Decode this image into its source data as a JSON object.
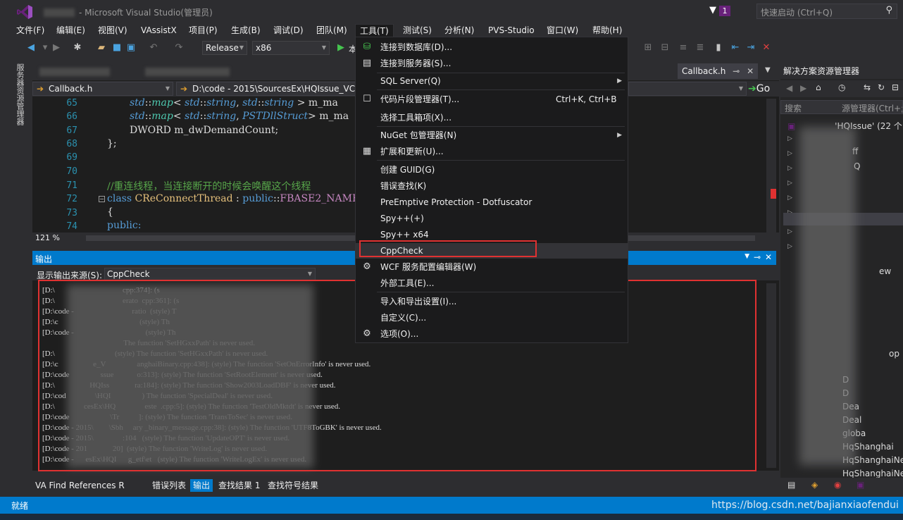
{
  "window": {
    "title": "- Microsoft Visual Studio(管理员)",
    "notification_count": "1",
    "quick_launch_placeholder": "快速启动 (Ctrl+Q)"
  },
  "menubar": [
    "文件(F)",
    "编辑(E)",
    "视图(V)",
    "VAssistX",
    "项目(P)",
    "生成(B)",
    "调试(D)",
    "团队(M)",
    "工具(T)",
    "测试(S)",
    "分析(N)",
    "PVS-Studio",
    "窗口(W)",
    "帮助(H)"
  ],
  "toolbar": {
    "configuration": "Release",
    "platform": "x86",
    "run_label": "本"
  },
  "left_sidebar": {
    "label": "服务器资源管理器"
  },
  "editor": {
    "tabs": [
      "Callback.h"
    ],
    "active_tab_right": "Callback.h",
    "nav_file": "Callback.h",
    "nav_scope": "D:\\code - 2015\\SourcesEx\\HQIssue_VC",
    "go_label": "Go",
    "zoom": "121 %",
    "lines": [
      {
        "num": "65",
        "text": "std::map< std::string, std::string > m_ma"
      },
      {
        "num": "66",
        "text": "std::map< std::string, PSTDllStruct> m_ma"
      },
      {
        "num": "67",
        "text": "DWORD m_dwDemandCount;"
      },
      {
        "num": "68",
        "text": "};"
      },
      {
        "num": "69",
        "text": ""
      },
      {
        "num": "70",
        "text": ""
      },
      {
        "num": "71",
        "text": "//重连线程，当连接断开的时候会唤醒这个线程"
      },
      {
        "num": "72",
        "text": "class CReConnectThread : public::FBASE2_NAMES"
      },
      {
        "num": "73",
        "text": "{"
      },
      {
        "num": "74",
        "text": "public:"
      }
    ]
  },
  "output": {
    "title": "输出",
    "source_label": "显示输出来源(S):",
    "source_value": "CppCheck",
    "lines": [
      "[D:\\                                   cpp:374]: (s",
      "[D:\\                                   erato  cpp:361]: (s",
      "[D:\\code -                              ratio  (style) T",
      "[D:\\c                                          (style) Th",
      "[D:\\code -                                     (style) Th",
      "                                          The function 'SetHGxxPath' is never used.",
      "[D:\\                               (style) The function 'SetHGxxPath' is never used.",
      "[D:\\c                  e_V                anghaiBinary.cpp:438]: (style) The function 'SetOnErrorInfo' is never used.",
      "[D:\\code                ssue            o:313]: (style) The function 'SetRootElement' is never used.",
      "[D:\\                  HQIss             ra:184]: (style) The function 'Show2003LoadDBF' is never used.",
      "[D:\\cod               \\HQI                ) The function 'SpecialDeal' is never used.",
      "[D:\\               cesEx\\HQ               este  .cpp:5]: (style) The function 'TestOldMktdt' is never used.",
      "[D:\\code                     \\Tr          ]: (style) The function 'TransToSec' is never used.",
      "[D:\\code - 2015\\        \\Sbh     ary _binary_message.cpp:38]: (style) The function 'UTF8ToGBK' is never used.",
      "[D:\\code - 2015\\               :104   (style) The function 'UpdateOPT' is never used.",
      "[D:\\code - 201             20]  (style) The function 'WriteLog' is never used.",
      "[D:\\code -      esEx\\HQI      g_etf\\et   (style) The function 'WriteLogEx' is never used."
    ]
  },
  "bottom_tabs": [
    "VA Find References R",
    "错误列表",
    "输出",
    "查找结果 1",
    "查找符号结果"
  ],
  "status": {
    "ready": "就绪",
    "watermark": "https://blog.csdn.net/bajianxiaofendui"
  },
  "solution_explorer": {
    "title": "解决方案资源管理器",
    "search_placeholder": "搜索",
    "search_suffix": "源管理器(Ctrl+;",
    "root": "'HQIssue' (22 个",
    "items": [
      "ff",
      "Q",
      "D",
      "D",
      "Dea",
      "Deal",
      "globa",
      "HqShanghai",
      "HqShanghaiNe",
      "HqShanghaiNe"
    ],
    "item_suffix_ew": "ew",
    "item_suffix_op": "op"
  },
  "tools_menu": {
    "items": [
      {
        "label": "连接到数据库(D)...",
        "icon": "database-icon"
      },
      {
        "label": "连接到服务器(S)...",
        "icon": "server-icon"
      },
      {
        "label": "SQL Server(Q)",
        "submenu": true
      },
      {
        "label": "代码片段管理器(T)...",
        "shortcut": "Ctrl+K, Ctrl+B",
        "icon": "checkbox-icon"
      },
      {
        "label": "选择工具箱项(X)..."
      },
      {
        "label": "NuGet 包管理器(N)",
        "submenu": true
      },
      {
        "label": "扩展和更新(U)...",
        "icon": "extensions-icon"
      },
      {
        "label": "创建 GUID(G)"
      },
      {
        "label": "错误查找(K)"
      },
      {
        "label": "PreEmptive Protection - Dotfuscator"
      },
      {
        "label": "Spy++(+)"
      },
      {
        "label": "Spy++ x64"
      },
      {
        "label": "CppCheck",
        "highlight": true
      },
      {
        "label": "WCF 服务配置编辑器(W)",
        "icon": "wcf-gear-icon"
      },
      {
        "label": "外部工具(E)..."
      },
      {
        "label": "导入和导出设置(I)..."
      },
      {
        "label": "自定义(C)..."
      },
      {
        "label": "选项(O)...",
        "icon": "gear-icon"
      }
    ]
  },
  "colors": {
    "accent": "#007acc",
    "highlight_box": "#e03131",
    "menu_bg": "#1b1b1c"
  }
}
